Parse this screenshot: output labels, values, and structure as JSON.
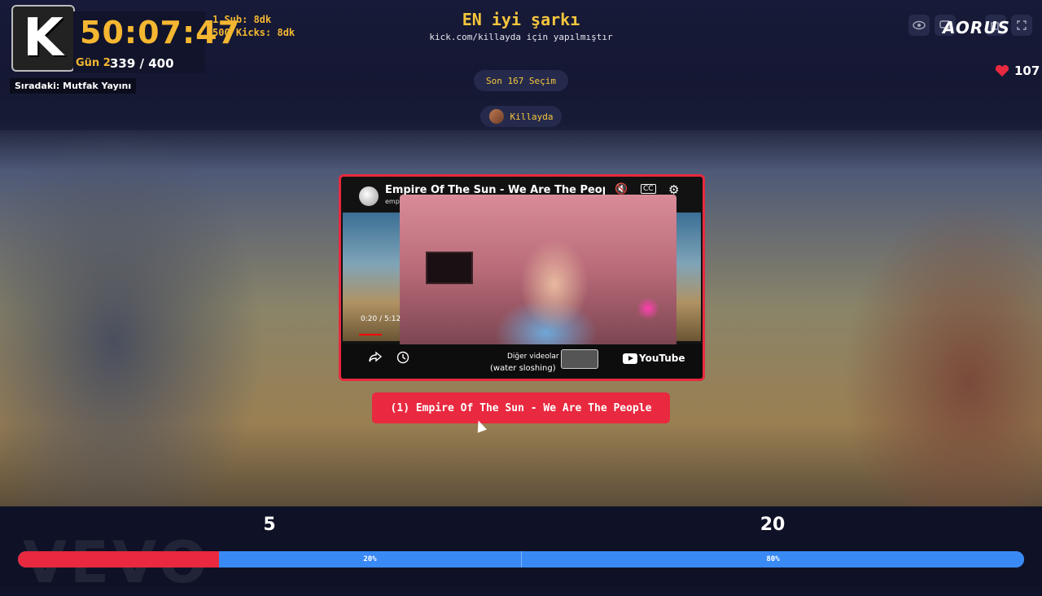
{
  "header": {
    "title": "EN iyi şarkı",
    "subtitle": "kick.com/killayda için yapılmıştır",
    "recent_picks": "Son 167 Seçim",
    "streamer": "Killayda"
  },
  "stream_widget": {
    "logo_letter": "K",
    "timer": "50:07:47",
    "day_label": "Gün 2",
    "day_progress": "339 / 400",
    "next_up": "Sıradaki: Mutfak Yayını",
    "incentives": [
      "1 Sub: 8dk",
      "500 Kicks: 8dk"
    ]
  },
  "top_right": {
    "icons": [
      "eye-icon",
      "chat-icon",
      "copy-icon",
      "fullscreen-icon"
    ],
    "sponsor": "AORUS",
    "hearts_count": "107"
  },
  "video": {
    "title": "Empire Of The Sun - We Are The People (",
    "channel": "emp",
    "time": "0:20 / 5:12",
    "progress": 0.064,
    "more_videos": "Diğer videolar",
    "caption": "(water sloshing)",
    "platform": "YouTube"
  },
  "now_playing": "(1) Empire Of The Sun - We Are The People",
  "vote": {
    "left_count": "5",
    "right_count": "20",
    "left_percent": "20%",
    "right_percent": "80%",
    "left_fraction": 0.2,
    "right_fraction": 0.8,
    "colors": {
      "left": "#e8293f",
      "right": "#3a8af5"
    }
  },
  "background_watermark": "VEVO"
}
